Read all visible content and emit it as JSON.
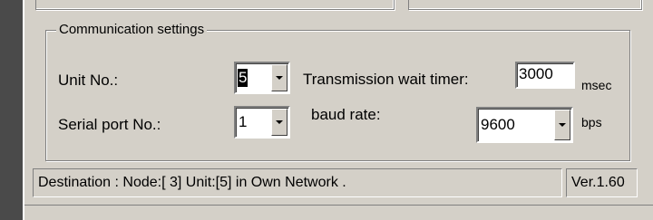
{
  "group": {
    "title": "Communication settings"
  },
  "unit_no": {
    "label": "Unit No.:",
    "value": "5"
  },
  "serial_port": {
    "label": "Serial port No.:",
    "value": "1"
  },
  "transmission_wait": {
    "label": "Transmission wait timer:",
    "value": "3000",
    "unit": "msec"
  },
  "baud_rate": {
    "label": "baud rate:",
    "value": "9600",
    "unit": "bps"
  },
  "status_bar": {
    "destination": "Destination : Node:[ 3]   Unit:[5]  in Own Network .",
    "version": "Ver.1.60"
  },
  "icons": {
    "dropdown": "chevron-down-icon"
  }
}
